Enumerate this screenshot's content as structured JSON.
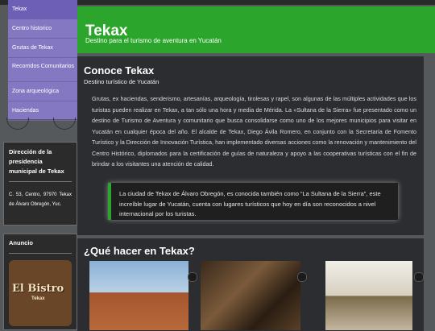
{
  "site": {
    "title": "Tekax",
    "subtitle": "Destino para el turismo de aventura en Yucatán"
  },
  "nav": {
    "items": [
      {
        "label": "Tekax",
        "active": true
      },
      {
        "label": "Centro historico"
      },
      {
        "label": "Grutas de Tekax"
      },
      {
        "label": "Recorridos Comunitarios"
      },
      {
        "label": "Zona arqueológica"
      },
      {
        "label": "Haciendas"
      }
    ]
  },
  "address": {
    "title": "Dirección de la presidencia municipal de Tekax",
    "text": "C. 53, Centro, 97970 Tekax de Álvaro Obregón, Yuc."
  },
  "ad": {
    "title": "Anuncio",
    "logo_text": "El Bistro",
    "logo_sub": "Tekax"
  },
  "main": {
    "heading": "Conoce Tekax",
    "kicker": "Destino turístico de Yucatán",
    "paragraph": "Grutas, ex haciendas, senderismo, artesanías, arqueología, tirolesas y rapel, son algunas de las múltiples actividades que los turistas pueden realizar en Tekax, a tan sólo una hora y media de Mérida. La «Sultana de la Sierra» fue presentado como un destino de Turismo de Aventura y comunitario que busca consolidarse como uno de los mejores municipios para visitar en Yucatán en cualquier época del año. El alcalde de Tekax, Diego Ávila Romero, en conjunto con la Secretaría de Fomento Turístico y la Dirección de Innovación Turística, han implementado diversas acciones como la renovación y mantenimiento del Centro Histórico, diplomados para la certificación de guías de naturaleza y apoyo a las cooperativas turísticas con el fin de brindar a los visitantes una atención de calidad.",
    "quote": "La ciudad de Tekax de Álvaro Obregón, es conocida también como “La Sultana de la Sierra”, este increíble lugar de Yucatán, cuenta con lugares turísticos que hoy en día son reconocidos a nivel internacional por los turistas."
  },
  "activities": {
    "heading": "¿Qué hacer en Tekax?"
  },
  "colors": {
    "accent": "#2ca52c",
    "nav": "#8478c2",
    "panel": "#2b2d30",
    "background": "#55595c"
  }
}
